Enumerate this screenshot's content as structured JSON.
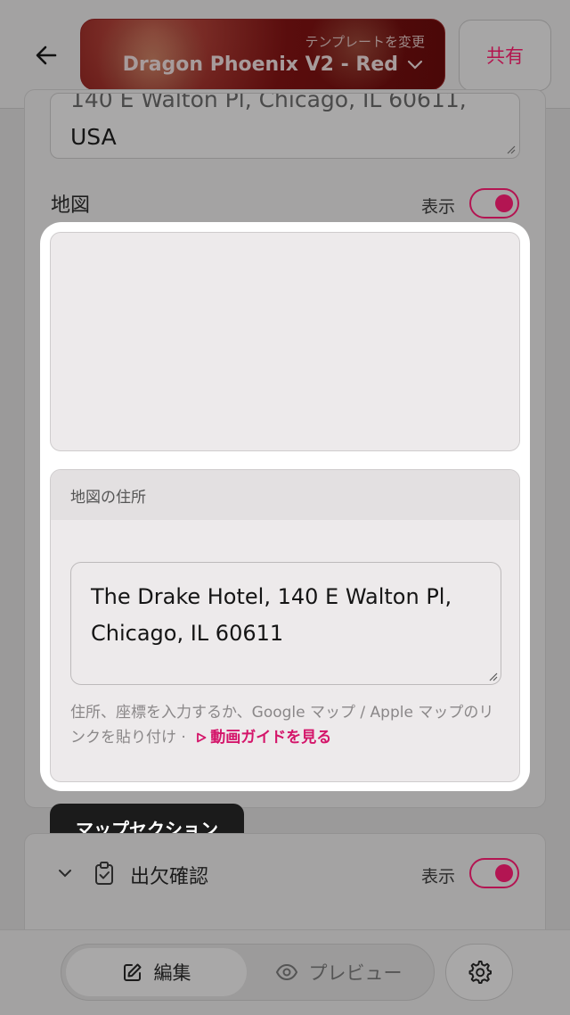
{
  "header": {
    "back_icon": "arrow-left-icon",
    "template_hint": "テンプレートを変更",
    "template_name": "Dragon Phoenix V2 - Red",
    "share_label": "共有"
  },
  "venue_address": {
    "value": "140 E Walton Pl, Chicago, IL 60611,\nUSA"
  },
  "map_section": {
    "label": "地図",
    "show_label": "表示",
    "show_enabled": true,
    "address_card_title": "地図の住所",
    "address_value": "The Drake Hotel, 140 E Walton Pl, Chicago, IL 60611",
    "help_text": "住所、座標を入力するか、Google マップ / Apple マップのリンクを貼り付け ·",
    "help_link": "動画ガイドを見る"
  },
  "tooltip": {
    "text": "マップセクション"
  },
  "attendance_section": {
    "title": "出欠確認",
    "show_label": "表示",
    "show_enabled": true
  },
  "bottom_nav": {
    "edit_label": "編集",
    "preview_label": "プレビュー",
    "settings_icon": "gear-icon"
  },
  "colors": {
    "accent": "#d4156a",
    "toggle_accent": "#b31552"
  }
}
